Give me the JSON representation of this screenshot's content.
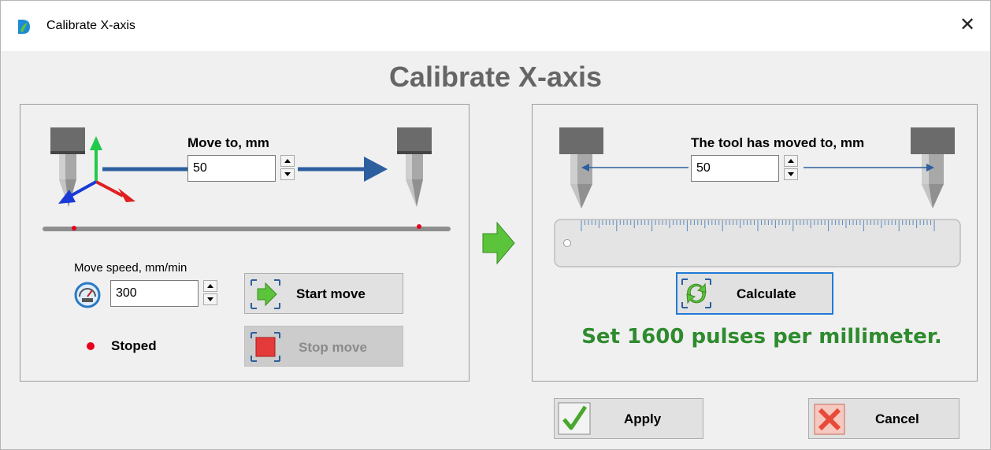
{
  "window": {
    "title": "Calibrate X-axis",
    "close_glyph": "✕"
  },
  "heading": "Calibrate X-axis",
  "move_panel": {
    "move_to_label": "Move to, mm",
    "move_to_value": "50",
    "speed_label": "Move speed, mm/min",
    "speed_value": "300",
    "start_button": "Start move",
    "stop_button": "Stop move",
    "status_text": "Stoped",
    "status_color": "#e8001c"
  },
  "measure_panel": {
    "moved_label": "The tool has moved to, mm",
    "moved_value": "50",
    "calculate_button": "Calculate",
    "result_text": "Set 1600 pulses per millimeter."
  },
  "footer": {
    "apply_button": "Apply",
    "cancel_button": "Cancel"
  },
  "colors": {
    "accent": "#2d5f9e",
    "result_green": "#2e8b2e",
    "arrow_green": "#5cc43a"
  }
}
